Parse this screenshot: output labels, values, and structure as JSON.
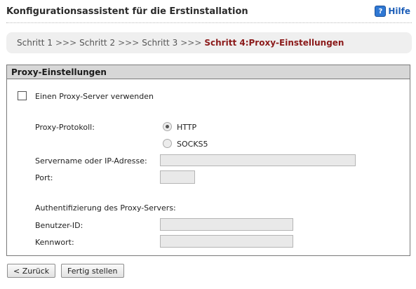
{
  "header": {
    "title": "Konfigurationsassistent für die Erstinstallation",
    "help_icon_glyph": "?",
    "help_label": "Hilfe"
  },
  "breadcrumb": {
    "steps": [
      "Schritt 1",
      "Schritt 2",
      "Schritt 3"
    ],
    "separator": ">>>",
    "active_step": "Schritt 4:Proxy-Einstellungen"
  },
  "panel": {
    "title": "Proxy-Einstellungen",
    "use_proxy": {
      "label": "Einen Proxy-Server verwenden",
      "checked": false
    },
    "protocol": {
      "label": "Proxy-Protokoll:",
      "options": [
        {
          "label": "HTTP",
          "selected": true
        },
        {
          "label": "SOCKS5",
          "selected": false
        }
      ]
    },
    "server": {
      "label": "Servername oder IP-Adresse:",
      "value": ""
    },
    "port": {
      "label": "Port:",
      "value": ""
    },
    "auth_heading": "Authentifizierung des Proxy-Servers:",
    "user_id": {
      "label": "Benutzer-ID:",
      "value": ""
    },
    "password": {
      "label": "Kennwort:",
      "value": ""
    }
  },
  "footer": {
    "back_label": "< Zurück",
    "finish_label": "Fertig stellen"
  },
  "colors": {
    "accent_link": "#1e5fb8",
    "active_step": "#8b1a1a",
    "panel_header_bg": "#d7d7d7"
  },
  "icons": {
    "help": "help-icon"
  }
}
